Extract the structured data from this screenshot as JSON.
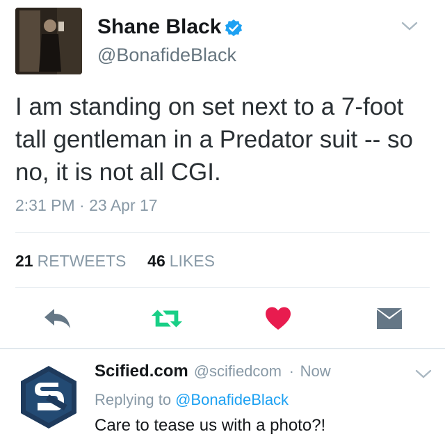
{
  "tweet": {
    "author_name": "Shane Black",
    "author_handle": "@BonafideBlack",
    "text": "I am standing on set next to a 7-foot tall gentleman in a Predator suit -- so no, it is not all CGI.",
    "time": "2:31 PM",
    "separator": "·",
    "date": "23 Apr 17",
    "retweets": {
      "count": "21",
      "label": "RETWEETS"
    },
    "likes": {
      "count": "46",
      "label": "LIKES"
    }
  },
  "actions": [
    {
      "icon": "reply-icon",
      "color": "#657786"
    },
    {
      "icon": "retweet-icon",
      "color": "#19cf86"
    },
    {
      "icon": "heart-icon",
      "color": "#e81c4f"
    },
    {
      "icon": "message-icon",
      "color": "#657786"
    }
  ],
  "reply": {
    "author_name": "Scified.com",
    "author_handle": "@scifiedcom",
    "separator": "·",
    "time": "Now",
    "replying_to_label": "Replying to",
    "replying_to_handle": "@BonafideBlack",
    "text": "Care to tease us with a photo?!"
  },
  "colors": {
    "verified": "#1da1f2",
    "link": "#1da1f2",
    "secondary_text": "#8899a6"
  }
}
